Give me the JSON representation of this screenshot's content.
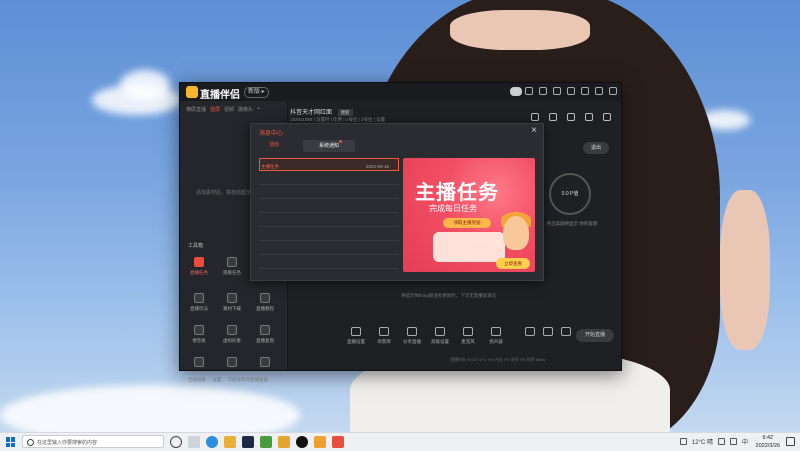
{
  "app": {
    "title": "直播伴侣",
    "version_badge": "新版 ▸",
    "sidebar_tabs": [
      "横屏直播",
      "竖屏",
      "视频",
      "摄像头",
      "+"
    ],
    "sidebar_hint": "添加素材后，将自动显示在此处",
    "tools_heading": "工具箱",
    "tools": [
      {
        "label": "直播任务",
        "icon": "task-icon"
      },
      {
        "label": "观看任务",
        "icon": "user-icon"
      },
      {
        "label": "直播玩法",
        "icon": "game-icon"
      },
      {
        "label": "素材下载",
        "icon": "download-icon"
      },
      {
        "label": "直播教程",
        "icon": "tutorial-icon"
      },
      {
        "label": "便签板",
        "icon": "note-icon"
      },
      {
        "label": "虚拟形象",
        "icon": "download-icon"
      },
      {
        "label": "直播复盘",
        "icon": "calendar-icon"
      },
      {
        "label": "",
        "icon": "more-icon"
      },
      {
        "label": "",
        "icon": "new-icon"
      },
      {
        "label": "",
        "icon": "download-icon"
      }
    ],
    "footer_text": "无线设备 ... 设置 ... 可能会影响直播画面",
    "main_title": "抖音天才网红面",
    "main_title_badge": "更新",
    "main_sub": "1920x1080 | 设置时 | 比例 | 1号位 | 2号位 | 设置",
    "exit_label": "退出",
    "beauty_value": "0.0 P值",
    "beauty_note": "开启美颜将显示\n你的容颜",
    "preview_note": "来提示你thing频道有更新时，下次无需重新填写",
    "bottom_tools": [
      "直播设置",
      "场景库",
      "分享直播",
      "高级设置",
      "麦克风",
      "扬声器"
    ],
    "start_live_label": "开始直播",
    "status_text": "直播时长 00:00 CPU 0% 内存 0% 丢帧 0% 码率 0kb/s"
  },
  "dialog": {
    "title": "消息中心",
    "tab1": "活动",
    "tab2": "系统通知",
    "items": [
      {
        "title": "主播任务",
        "date": "2022-03-16"
      }
    ],
    "banner": {
      "title": "主播任务",
      "subtitle": "完成每日任务",
      "tag": "领取主播奖励",
      "button": "立即查看"
    }
  },
  "taskbar": {
    "search_placeholder": "在这里输入你要搜索的内容",
    "weather": "12°C 晴",
    "lang": "中",
    "time": "9:42",
    "date": "2022/3/26"
  }
}
